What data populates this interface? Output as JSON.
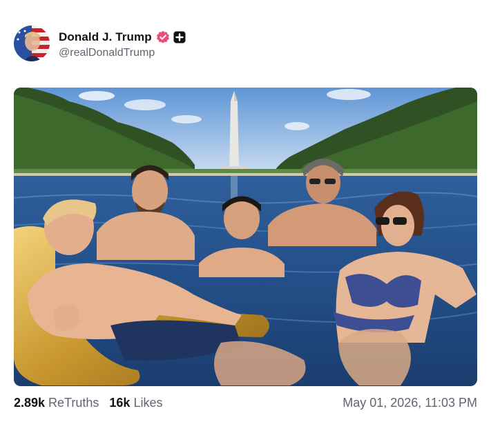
{
  "author": {
    "display_name": "Donald J. Trump",
    "handle": "@realDonaldTrump",
    "avatar_icon": "flag-portrait-avatar",
    "verified_icon": "verified-badge-icon",
    "verified_color": "#e8507a",
    "plus_icon": "plus-badge-icon"
  },
  "media": {
    "kind": "photo",
    "scene_icon": "reflecting-pool-photo"
  },
  "stats": {
    "retruths_count": "2.89k",
    "retruths_label": "ReTruths",
    "likes_count": "16k",
    "likes_label": "Likes"
  },
  "timestamp": "May 01, 2026, 11:03 PM",
  "colors": {
    "text_primary": "#111111",
    "text_secondary": "#5e6570",
    "background": "#ffffff"
  }
}
